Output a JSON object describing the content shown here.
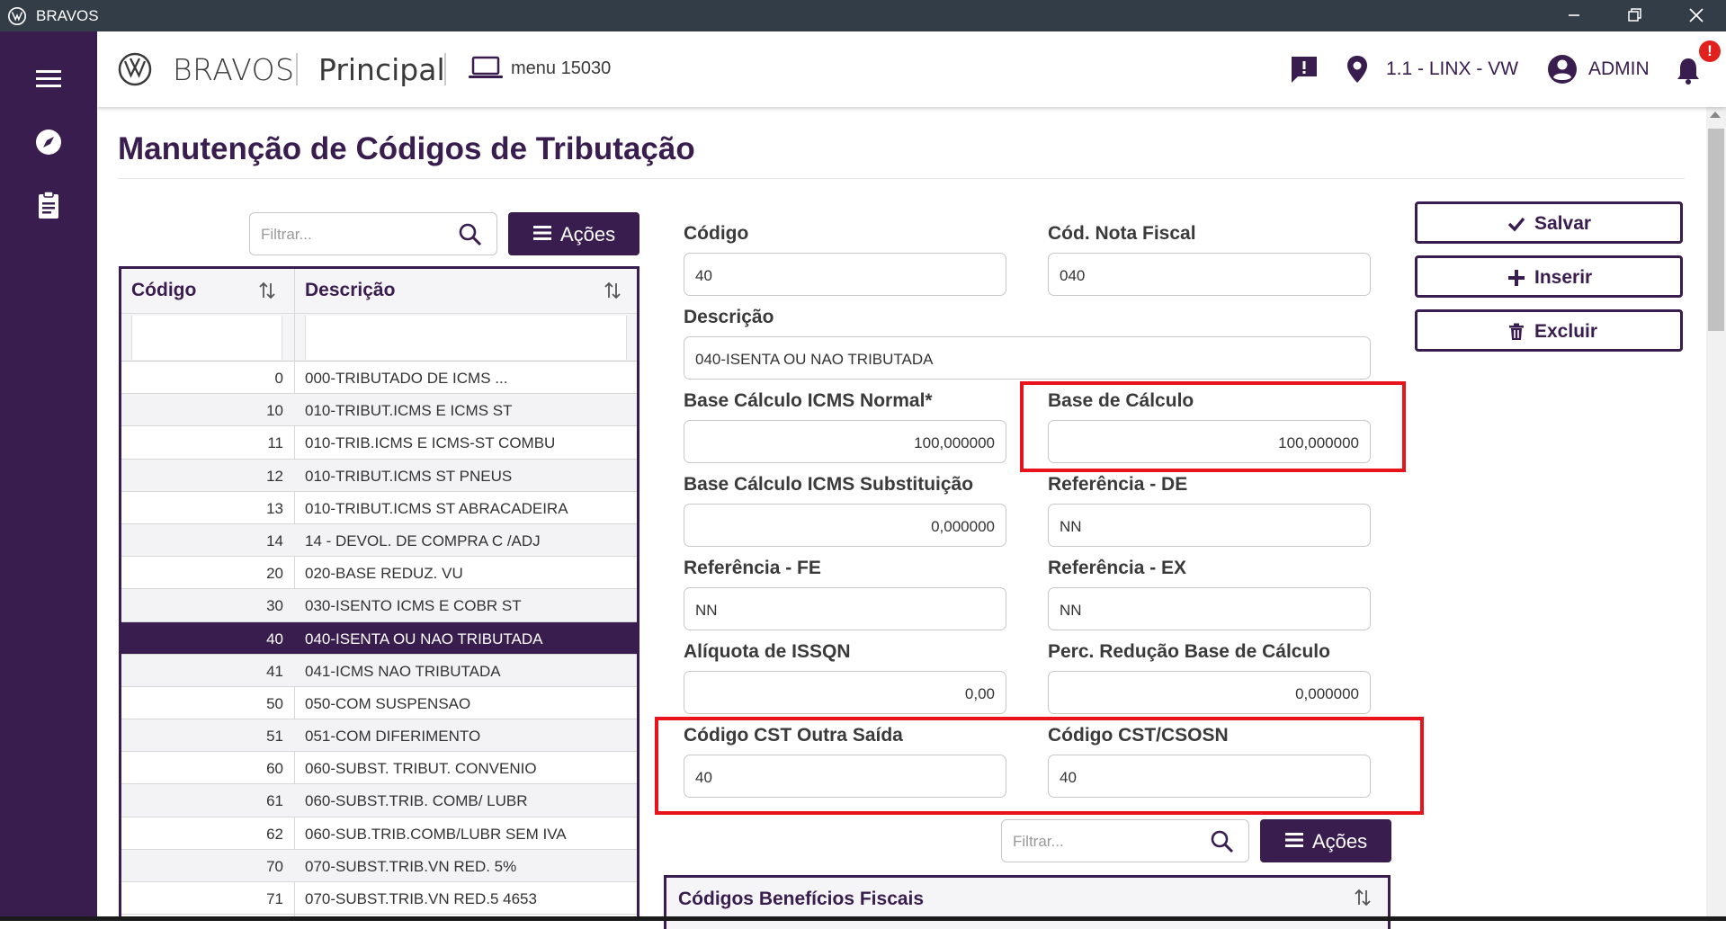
{
  "window": {
    "title": "BRAVOS"
  },
  "header": {
    "brand": "BRAVOS",
    "module": "Principal",
    "menu_code": "menu 15030",
    "store": "1.1 - LINX - VW",
    "user": "ADMIN",
    "notification_badge": "!"
  },
  "page": {
    "title": "Manutenção de Códigos de Tributação"
  },
  "list": {
    "filter_placeholder": "Filtrar...",
    "actions_label": "Ações",
    "columns": [
      "Código",
      "Descrição"
    ],
    "rows": [
      {
        "code": "0",
        "desc": "000-TRIBUTADO DE ICMS ..."
      },
      {
        "code": "10",
        "desc": "010-TRIBUT.ICMS E ICMS ST"
      },
      {
        "code": "11",
        "desc": "010-TRIB.ICMS E ICMS-ST COMBU"
      },
      {
        "code": "12",
        "desc": "010-TRIBUT.ICMS ST PNEUS"
      },
      {
        "code": "13",
        "desc": "010-TRIBUT.ICMS ST ABRACADEIRA"
      },
      {
        "code": "14",
        "desc": "14 - DEVOL. DE COMPRA C /ADJ"
      },
      {
        "code": "20",
        "desc": "020-BASE REDUZ. VU"
      },
      {
        "code": "30",
        "desc": "030-ISENTO ICMS E COBR ST"
      },
      {
        "code": "40",
        "desc": "040-ISENTA OU NAO TRIBUTADA",
        "selected": true
      },
      {
        "code": "41",
        "desc": "041-ICMS NAO TRIBUTADA"
      },
      {
        "code": "50",
        "desc": "050-COM SUSPENSAO"
      },
      {
        "code": "51",
        "desc": "051-COM DIFERIMENTO"
      },
      {
        "code": "60",
        "desc": "060-SUBST. TRIBUT. CONVENIO"
      },
      {
        "code": "61",
        "desc": "060-SUBST.TRIB. COMB/ LUBR"
      },
      {
        "code": "62",
        "desc": "060-SUB.TRIB.COMB/LUBR SEM IVA"
      },
      {
        "code": "70",
        "desc": "070-SUBST.TRIB.VN RED. 5%"
      },
      {
        "code": "71",
        "desc": "070-SUBST.TRIB.VN RED.5 4653"
      }
    ]
  },
  "form": {
    "codigo": {
      "label": "Código",
      "value": "40"
    },
    "cod_nota_fiscal": {
      "label": "Cód. Nota Fiscal",
      "value": "040"
    },
    "descricao": {
      "label": "Descrição",
      "value": "040-ISENTA OU NAO TRIBUTADA"
    },
    "base_icms_normal": {
      "label": "Base Cálculo ICMS Normal*",
      "value": "100,000000"
    },
    "base_calculo": {
      "label": "Base de Cálculo",
      "value": "100,000000"
    },
    "base_icms_subst": {
      "label": "Base Cálculo ICMS Substituição",
      "value": "0,000000"
    },
    "referencia_de": {
      "label": "Referência - DE",
      "value": "NN"
    },
    "referencia_fe": {
      "label": "Referência - FE",
      "value": "NN"
    },
    "referencia_ex": {
      "label": "Referência - EX",
      "value": "NN"
    },
    "aliquota_issqn": {
      "label": "Alíquota de ISSQN",
      "value": "0,00"
    },
    "perc_reducao": {
      "label": "Perc. Redução Base de Cálculo",
      "value": "0,000000"
    },
    "cst_outra_saida": {
      "label": "Código CST Outra Saída",
      "value": "40"
    },
    "cst_csosn": {
      "label": "Código CST/CSOSN",
      "value": "40"
    }
  },
  "actions": {
    "save": "Salvar",
    "insert": "Inserir",
    "delete": "Excluir"
  },
  "benefits": {
    "filter_placeholder": "Filtrar...",
    "actions_label": "Ações",
    "grid_title": "Códigos Benefícios Fiscais"
  },
  "colors": {
    "primary": "#3a1d4f",
    "highlight": "#e8131b",
    "titlebar": "#323d48"
  }
}
